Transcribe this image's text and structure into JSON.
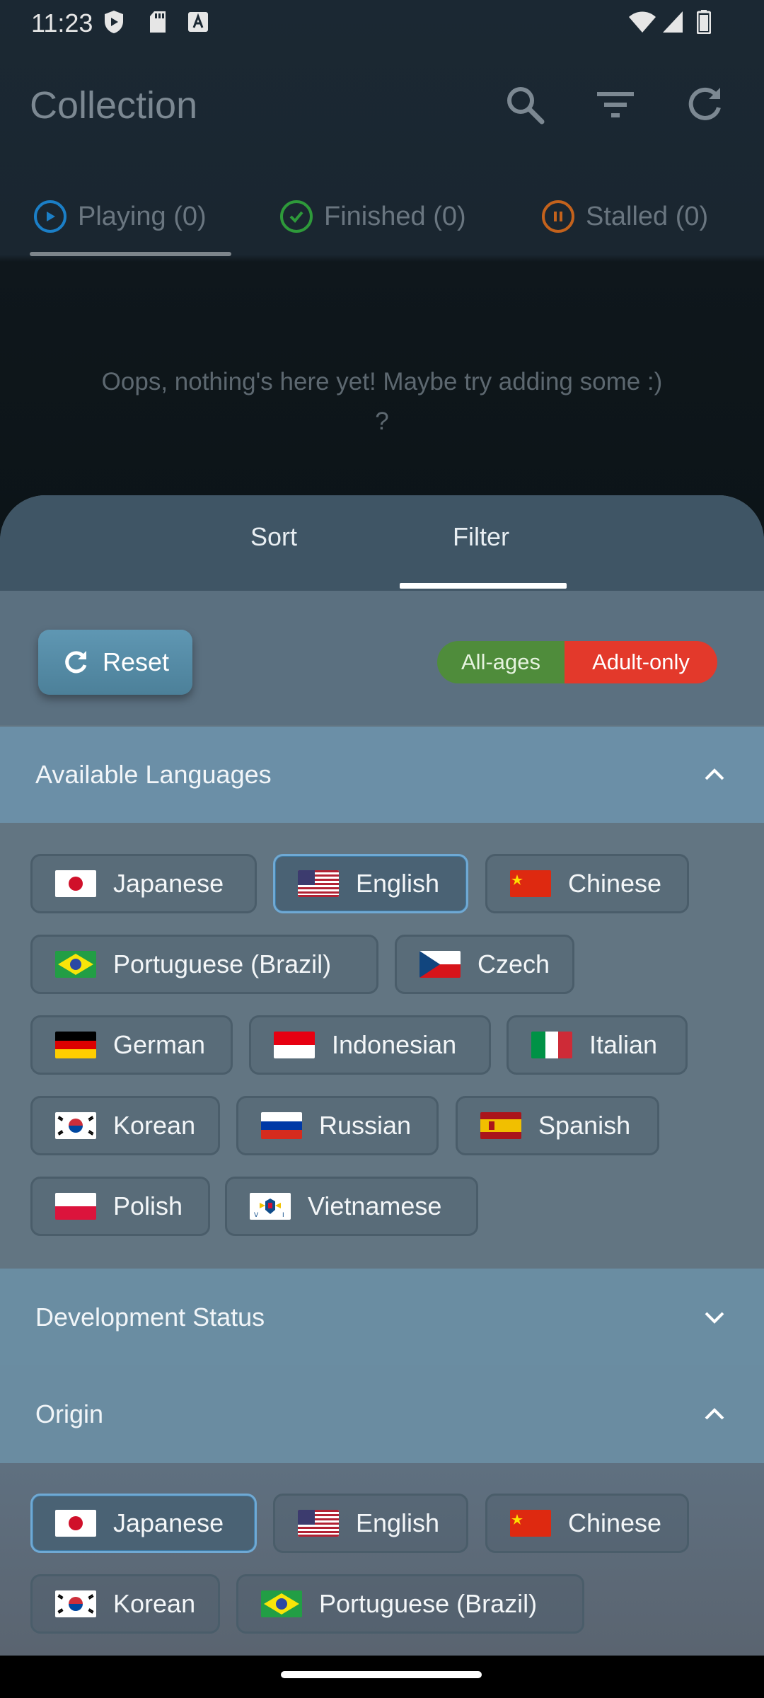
{
  "status_bar": {
    "time": "11:23"
  },
  "app_bar": {
    "title": "Collection",
    "icons": [
      "search-icon",
      "filter-icon",
      "refresh-icon"
    ]
  },
  "status_tabs": [
    {
      "label": "Playing (0)",
      "color": "#1b7fc7"
    },
    {
      "label": "Finished (0)",
      "color": "#2e9a3a"
    },
    {
      "label": "Stalled (0)",
      "color": "#c4621c"
    }
  ],
  "empty_message": "Oops, nothing's here yet! Maybe try adding some :) ?",
  "sheet": {
    "tabs": [
      "Sort",
      "Filter"
    ],
    "active_tab": "Filter",
    "reset_label": "Reset",
    "age_filter": {
      "all_ages": "All-ages",
      "adult_only": "Adult-only"
    },
    "sections": {
      "available_languages": {
        "title": "Available Languages",
        "expanded": true,
        "chips": [
          {
            "label": "Japanese",
            "flag": "jp",
            "selected": false
          },
          {
            "label": "English",
            "flag": "us",
            "selected": true
          },
          {
            "label": "Chinese",
            "flag": "cn",
            "selected": false
          },
          {
            "label": "Portuguese (Brazil)",
            "flag": "br",
            "selected": false
          },
          {
            "label": "Czech",
            "flag": "cz",
            "selected": false
          },
          {
            "label": "German",
            "flag": "de",
            "selected": false
          },
          {
            "label": "Indonesian",
            "flag": "id",
            "selected": false
          },
          {
            "label": "Italian",
            "flag": "it",
            "selected": false
          },
          {
            "label": "Korean",
            "flag": "kr",
            "selected": false
          },
          {
            "label": "Russian",
            "flag": "ru",
            "selected": false
          },
          {
            "label": "Spanish",
            "flag": "es",
            "selected": false
          },
          {
            "label": "Polish",
            "flag": "pl",
            "selected": false
          },
          {
            "label": "Vietnamese",
            "flag": "vi",
            "selected": false
          }
        ]
      },
      "development_status": {
        "title": "Development Status",
        "expanded": false
      },
      "origin": {
        "title": "Origin",
        "expanded": true,
        "chips": [
          {
            "label": "Japanese",
            "flag": "jp",
            "selected": true
          },
          {
            "label": "English",
            "flag": "us",
            "selected": false
          },
          {
            "label": "Chinese",
            "flag": "cn",
            "selected": false
          },
          {
            "label": "Korean",
            "flag": "kr",
            "selected": false
          },
          {
            "label": "Portuguese (Brazil)",
            "flag": "br",
            "selected": false
          }
        ]
      }
    }
  }
}
